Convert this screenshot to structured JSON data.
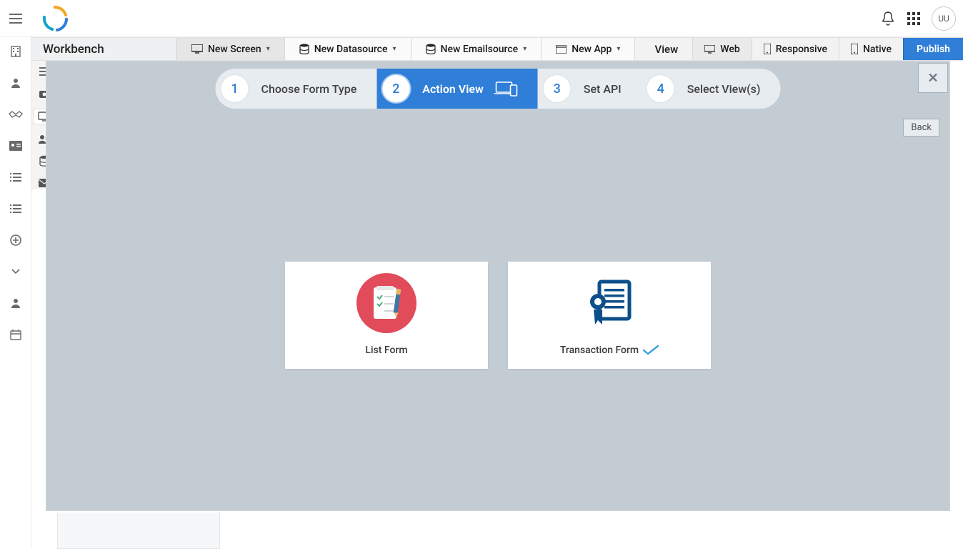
{
  "header": {
    "avatar_initials": "UU"
  },
  "toolbar": {
    "title": "Workbench",
    "new_screen": "New Screen",
    "new_datasource": "New Datasource",
    "new_emailsource": "New Emailsource",
    "new_app": "New App",
    "view_label": "View",
    "tab_web": "Web",
    "tab_responsive": "Responsive",
    "tab_native": "Native",
    "publish": "Publish"
  },
  "stepper": {
    "steps": [
      {
        "num": "1",
        "label": "Choose Form Type"
      },
      {
        "num": "2",
        "label": "Action View"
      },
      {
        "num": "3",
        "label": "Set API"
      },
      {
        "num": "4",
        "label": "Select View(s)"
      }
    ]
  },
  "modal": {
    "close_label": "✕",
    "back_label": "Back"
  },
  "cards": {
    "list_form": "List Form",
    "transaction_form": "Transaction Form"
  }
}
